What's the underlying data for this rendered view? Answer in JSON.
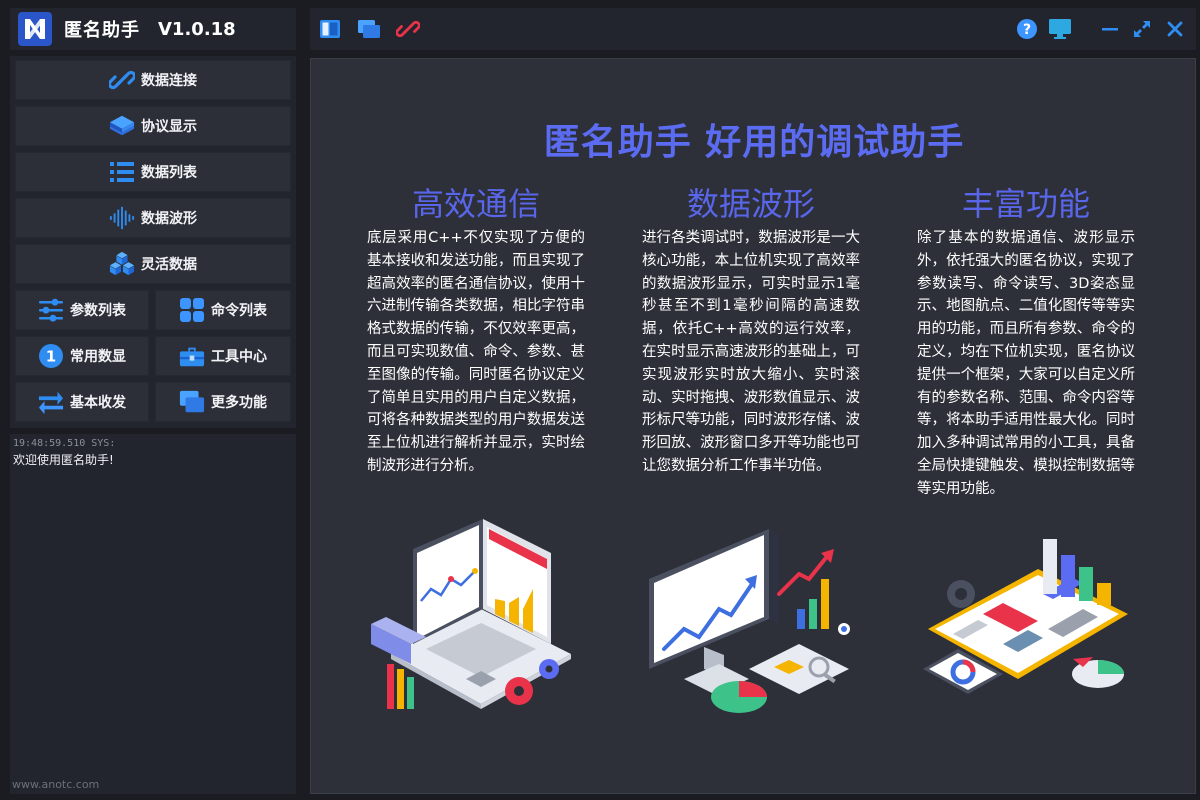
{
  "app": {
    "title": "匿名助手",
    "version": "V1.0.18"
  },
  "nav": {
    "data_connect": "数据连接",
    "protocol_display": "协议显示",
    "data_list": "数据列表",
    "data_waveform": "数据波形",
    "flexible_data": "灵活数据",
    "param_list": "参数列表",
    "command_list": "命令列表",
    "common_display": "常用数显",
    "tool_center": "工具中心",
    "basic_transceive": "基本收发",
    "more_features": "更多功能",
    "common_display_badge": "1"
  },
  "log": {
    "timestamp": "19:48:59.510 SYS:",
    "message": "欢迎使用匿名助手!"
  },
  "watermark": "www.anotc.com",
  "main": {
    "hero": "匿名助手 好用的调试助手",
    "columns": [
      {
        "title": "高效通信",
        "text": "底层采用C++不仅实现了方便的基本接收和发送功能，而且实现了超高效率的匿名通信协议，使用十六进制传输各类数据，相比字符串格式数据的传输，不仅效率更高，而且可实现数值、命令、参数、甚至图像的传输。同时匿名协议定义了简单且实用的用户自定义数据，可将各种数据类型的用户数据发送至上位机进行解析并显示，实时绘制波形进行分析。"
      },
      {
        "title": "数据波形",
        "text": "进行各类调试时，数据波形是一大核心功能，本上位机实现了高效率的数据波形显示，可实时显示1毫秒甚至不到1毫秒间隔的高速数据，依托C++高效的运行效率，在实时显示高速波形的基础上，可实现波形实时放大缩小、实时滚动、实时拖拽、波形数值显示、波形标尺等功能，同时波形存储、波形回放、波形窗口多开等功能也可让您数据分析工作事半功倍。"
      },
      {
        "title": "丰富功能",
        "text": "除了基本的数据通信、波形显示外，依托强大的匿名协议，实现了参数读写、命令读写、3D姿态显示、地图航点、二值化图传等等实用的功能，而且所有参数、命令的定义，均在下位机实现，匿名协议提供一个框架，大家可以自定义所有的参数名称、范围、命令内容等等，将本助手适用性最大化。同时加入多种调试常用的小工具，具备全局快捷键触发、模拟控制数据等等实用功能。"
      }
    ]
  },
  "icons": {
    "logo": "anonymous-logo-icon",
    "toolbar": [
      "panel-toggle-icon",
      "windows-icon",
      "link-icon",
      "help-icon",
      "monitor-icon",
      "minimize-icon",
      "maximize-icon",
      "close-icon"
    ]
  },
  "colors": {
    "accent": "#5c6cf2",
    "icon_blue": "#2f8cf0",
    "link_red": "#e8334a",
    "bg": "#1a1c22",
    "panel": "#22252d",
    "content": "#2d3039"
  }
}
